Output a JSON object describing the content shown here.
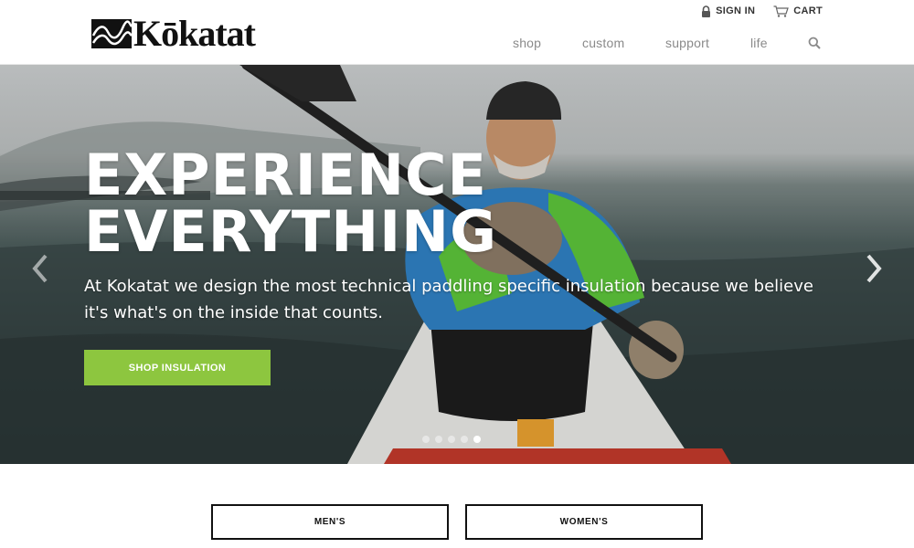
{
  "brand": {
    "name": "Kōkatat"
  },
  "util_nav": {
    "sign_in": "SIGN IN",
    "cart": "CART"
  },
  "main_nav": {
    "items": [
      "shop",
      "custom",
      "support",
      "life"
    ],
    "search_icon": "search-icon"
  },
  "hero": {
    "title_line1": "EXPERIENCE",
    "title_line2": "EVERYTHING",
    "description": "At Kokatat we design the most technical paddling specific insulation because we believe it's what's on the inside that counts.",
    "cta_label": "SHOP INSULATION",
    "cta_color": "#8dc63f",
    "slide_count": 5,
    "active_slide": 5
  },
  "categories": {
    "mens": "MEN'S",
    "womens": "WOMEN'S"
  }
}
